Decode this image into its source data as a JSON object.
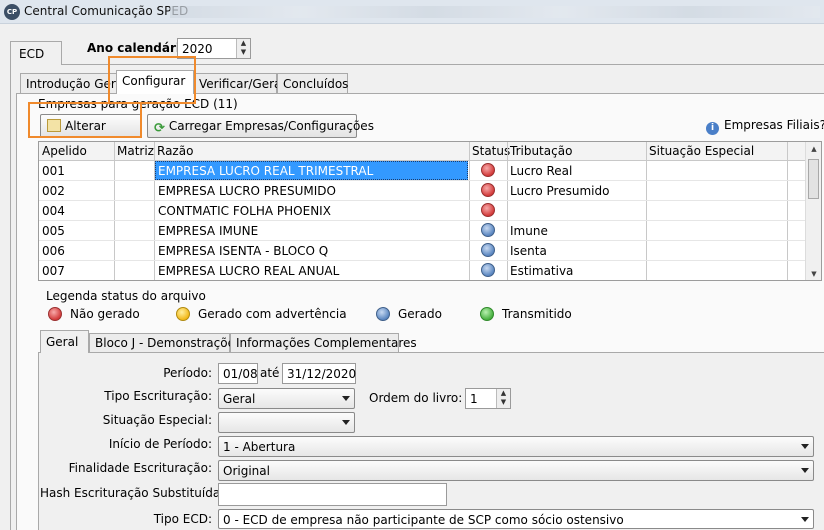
{
  "window": {
    "title": "Central Comunicação SPED",
    "logo_text": "CP"
  },
  "top_tab": "ECD",
  "ano": {
    "label": "Ano calendário:",
    "value": "2020"
  },
  "tabs": [
    "Introdução Geral",
    "Configurar",
    "Verificar/Gerar",
    "Concluídos"
  ],
  "group_label": "Empresas para geração ECD (11)",
  "toolbar": {
    "alterar": "Alterar",
    "carregar": "Carregar Empresas/Configurações",
    "filiais": "Empresas Filiais?"
  },
  "table": {
    "headers": [
      "Apelido",
      "Matriz",
      "Razão",
      "Status",
      "Tributação",
      "Situação Especial"
    ],
    "rows": [
      {
        "apelido": "001",
        "razao": "EMPRESA LUCRO REAL TRIMESTRAL",
        "status": "red",
        "tributacao": "Lucro Real"
      },
      {
        "apelido": "002",
        "razao": "EMPRESA LUCRO PRESUMIDO",
        "status": "red",
        "tributacao": "Lucro Presumido"
      },
      {
        "apelido": "004",
        "razao": "CONTMATIC FOLHA PHOENIX",
        "status": "red",
        "tributacao": ""
      },
      {
        "apelido": "005",
        "razao": "EMPRESA IMUNE",
        "status": "blue",
        "tributacao": "Imune"
      },
      {
        "apelido": "006",
        "razao": "EMPRESA ISENTA - BLOCO Q",
        "status": "blue",
        "tributacao": "Isenta"
      },
      {
        "apelido": "007",
        "razao": "EMPRESA LUCRO REAL ANUAL",
        "status": "blue",
        "tributacao": "Estimativa"
      }
    ]
  },
  "legend": {
    "title": "Legenda status do arquivo",
    "items": [
      "Não gerado",
      "Gerado com advertência",
      "Gerado",
      "Transmitido"
    ]
  },
  "bottom_tabs": [
    "Geral",
    "Bloco J - Demonstrações",
    "Informações Complementares"
  ],
  "form": {
    "periodo_label": "Período:",
    "periodo_inicio": "01/08",
    "ate": "até",
    "periodo_fim": "31/12/2020",
    "tipo_escrituracao_label": "Tipo Escrituração:",
    "tipo_escrituracao": "Geral",
    "ordem_livro_label": "Ordem do livro:",
    "ordem_livro": "1",
    "situacao_especial_label": "Situação Especial:",
    "situacao_especial": "",
    "inicio_periodo_label": "Início de Período:",
    "inicio_periodo": "1 - Abertura",
    "finalidade_label": "Finalidade Escrituração:",
    "finalidade": "Original",
    "hash_label": "Hash Escrituração Substituída:",
    "hash": "",
    "tipo_ecd_label": "Tipo ECD:",
    "tipo_ecd": "0 - ECD de empresa não participante de SCP como sócio ostensivo"
  }
}
